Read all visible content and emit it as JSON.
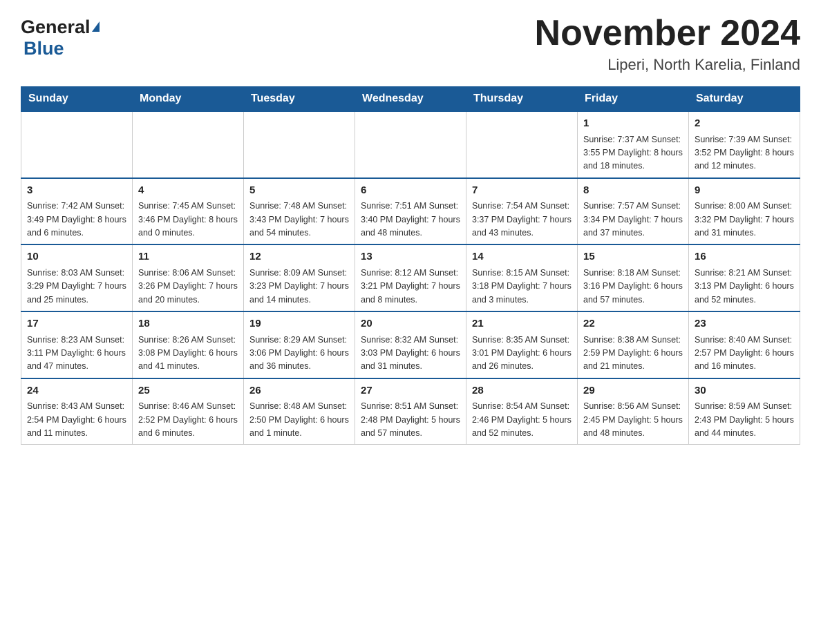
{
  "header": {
    "logo_general": "General",
    "logo_blue": "Blue",
    "month_title": "November 2024",
    "location": "Liperi, North Karelia, Finland"
  },
  "calendar": {
    "days_of_week": [
      "Sunday",
      "Monday",
      "Tuesday",
      "Wednesday",
      "Thursday",
      "Friday",
      "Saturday"
    ],
    "weeks": [
      {
        "days": [
          {
            "number": "",
            "info": ""
          },
          {
            "number": "",
            "info": ""
          },
          {
            "number": "",
            "info": ""
          },
          {
            "number": "",
            "info": ""
          },
          {
            "number": "",
            "info": ""
          },
          {
            "number": "1",
            "info": "Sunrise: 7:37 AM\nSunset: 3:55 PM\nDaylight: 8 hours\nand 18 minutes."
          },
          {
            "number": "2",
            "info": "Sunrise: 7:39 AM\nSunset: 3:52 PM\nDaylight: 8 hours\nand 12 minutes."
          }
        ]
      },
      {
        "days": [
          {
            "number": "3",
            "info": "Sunrise: 7:42 AM\nSunset: 3:49 PM\nDaylight: 8 hours\nand 6 minutes."
          },
          {
            "number": "4",
            "info": "Sunrise: 7:45 AM\nSunset: 3:46 PM\nDaylight: 8 hours\nand 0 minutes."
          },
          {
            "number": "5",
            "info": "Sunrise: 7:48 AM\nSunset: 3:43 PM\nDaylight: 7 hours\nand 54 minutes."
          },
          {
            "number": "6",
            "info": "Sunrise: 7:51 AM\nSunset: 3:40 PM\nDaylight: 7 hours\nand 48 minutes."
          },
          {
            "number": "7",
            "info": "Sunrise: 7:54 AM\nSunset: 3:37 PM\nDaylight: 7 hours\nand 43 minutes."
          },
          {
            "number": "8",
            "info": "Sunrise: 7:57 AM\nSunset: 3:34 PM\nDaylight: 7 hours\nand 37 minutes."
          },
          {
            "number": "9",
            "info": "Sunrise: 8:00 AM\nSunset: 3:32 PM\nDaylight: 7 hours\nand 31 minutes."
          }
        ]
      },
      {
        "days": [
          {
            "number": "10",
            "info": "Sunrise: 8:03 AM\nSunset: 3:29 PM\nDaylight: 7 hours\nand 25 minutes."
          },
          {
            "number": "11",
            "info": "Sunrise: 8:06 AM\nSunset: 3:26 PM\nDaylight: 7 hours\nand 20 minutes."
          },
          {
            "number": "12",
            "info": "Sunrise: 8:09 AM\nSunset: 3:23 PM\nDaylight: 7 hours\nand 14 minutes."
          },
          {
            "number": "13",
            "info": "Sunrise: 8:12 AM\nSunset: 3:21 PM\nDaylight: 7 hours\nand 8 minutes."
          },
          {
            "number": "14",
            "info": "Sunrise: 8:15 AM\nSunset: 3:18 PM\nDaylight: 7 hours\nand 3 minutes."
          },
          {
            "number": "15",
            "info": "Sunrise: 8:18 AM\nSunset: 3:16 PM\nDaylight: 6 hours\nand 57 minutes."
          },
          {
            "number": "16",
            "info": "Sunrise: 8:21 AM\nSunset: 3:13 PM\nDaylight: 6 hours\nand 52 minutes."
          }
        ]
      },
      {
        "days": [
          {
            "number": "17",
            "info": "Sunrise: 8:23 AM\nSunset: 3:11 PM\nDaylight: 6 hours\nand 47 minutes."
          },
          {
            "number": "18",
            "info": "Sunrise: 8:26 AM\nSunset: 3:08 PM\nDaylight: 6 hours\nand 41 minutes."
          },
          {
            "number": "19",
            "info": "Sunrise: 8:29 AM\nSunset: 3:06 PM\nDaylight: 6 hours\nand 36 minutes."
          },
          {
            "number": "20",
            "info": "Sunrise: 8:32 AM\nSunset: 3:03 PM\nDaylight: 6 hours\nand 31 minutes."
          },
          {
            "number": "21",
            "info": "Sunrise: 8:35 AM\nSunset: 3:01 PM\nDaylight: 6 hours\nand 26 minutes."
          },
          {
            "number": "22",
            "info": "Sunrise: 8:38 AM\nSunset: 2:59 PM\nDaylight: 6 hours\nand 21 minutes."
          },
          {
            "number": "23",
            "info": "Sunrise: 8:40 AM\nSunset: 2:57 PM\nDaylight: 6 hours\nand 16 minutes."
          }
        ]
      },
      {
        "days": [
          {
            "number": "24",
            "info": "Sunrise: 8:43 AM\nSunset: 2:54 PM\nDaylight: 6 hours\nand 11 minutes."
          },
          {
            "number": "25",
            "info": "Sunrise: 8:46 AM\nSunset: 2:52 PM\nDaylight: 6 hours\nand 6 minutes."
          },
          {
            "number": "26",
            "info": "Sunrise: 8:48 AM\nSunset: 2:50 PM\nDaylight: 6 hours\nand 1 minute."
          },
          {
            "number": "27",
            "info": "Sunrise: 8:51 AM\nSunset: 2:48 PM\nDaylight: 5 hours\nand 57 minutes."
          },
          {
            "number": "28",
            "info": "Sunrise: 8:54 AM\nSunset: 2:46 PM\nDaylight: 5 hours\nand 52 minutes."
          },
          {
            "number": "29",
            "info": "Sunrise: 8:56 AM\nSunset: 2:45 PM\nDaylight: 5 hours\nand 48 minutes."
          },
          {
            "number": "30",
            "info": "Sunrise: 8:59 AM\nSunset: 2:43 PM\nDaylight: 5 hours\nand 44 minutes."
          }
        ]
      }
    ]
  }
}
